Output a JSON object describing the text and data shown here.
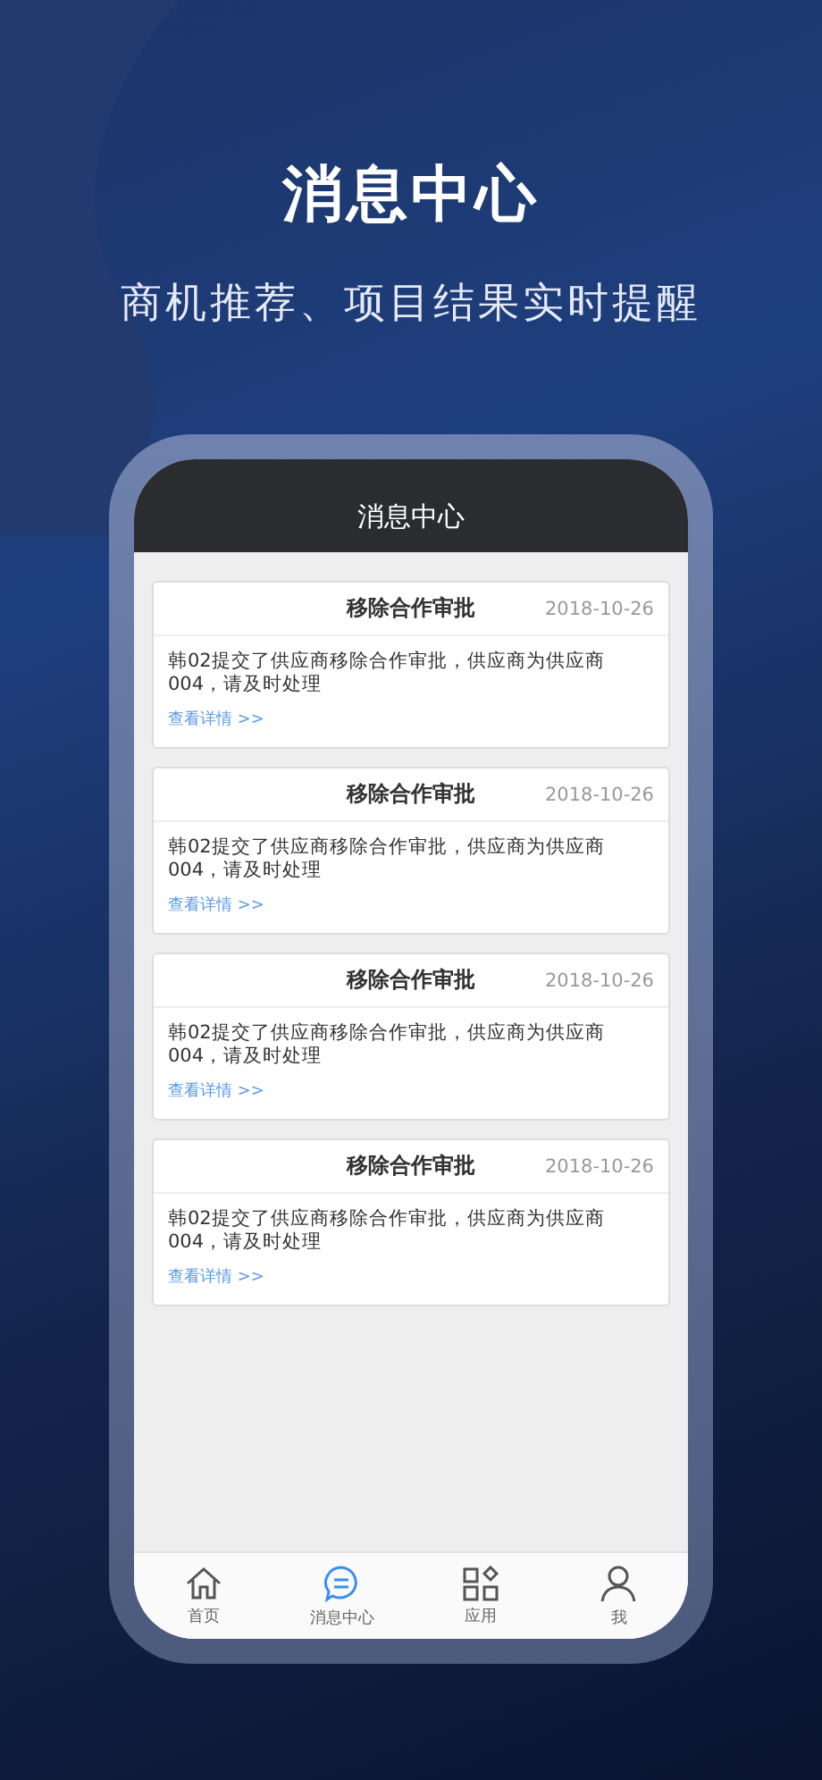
{
  "headline": "消息中心",
  "subtitle": "商机推荐、项目结果实时提醒",
  "screen": {
    "title": "消息中心",
    "messages": [
      {
        "title": "移除合作审批",
        "date": "2018-10-26",
        "body": "韩02提交了供应商移除合作审批，供应商为供应商004，请及时处理",
        "link": "查看详情 >>"
      },
      {
        "title": "移除合作审批",
        "date": "2018-10-26",
        "body": "韩02提交了供应商移除合作审批，供应商为供应商004，请及时处理",
        "link": "查看详情 >>"
      },
      {
        "title": "移除合作审批",
        "date": "2018-10-26",
        "body": "韩02提交了供应商移除合作审批，供应商为供应商004，请及时处理",
        "link": "查看详情 >>"
      },
      {
        "title": "移除合作审批",
        "date": "2018-10-26",
        "body": "韩02提交了供应商移除合作审批，供应商为供应商004，请及时处理",
        "link": "查看详情 >>"
      }
    ],
    "tabs": [
      {
        "kind": "home",
        "label": "首页",
        "selected": false
      },
      {
        "kind": "message",
        "label": "消息中心",
        "selected": true
      },
      {
        "kind": "apps",
        "label": "应用",
        "selected": false
      },
      {
        "kind": "profile",
        "label": "我",
        "selected": false
      }
    ]
  }
}
